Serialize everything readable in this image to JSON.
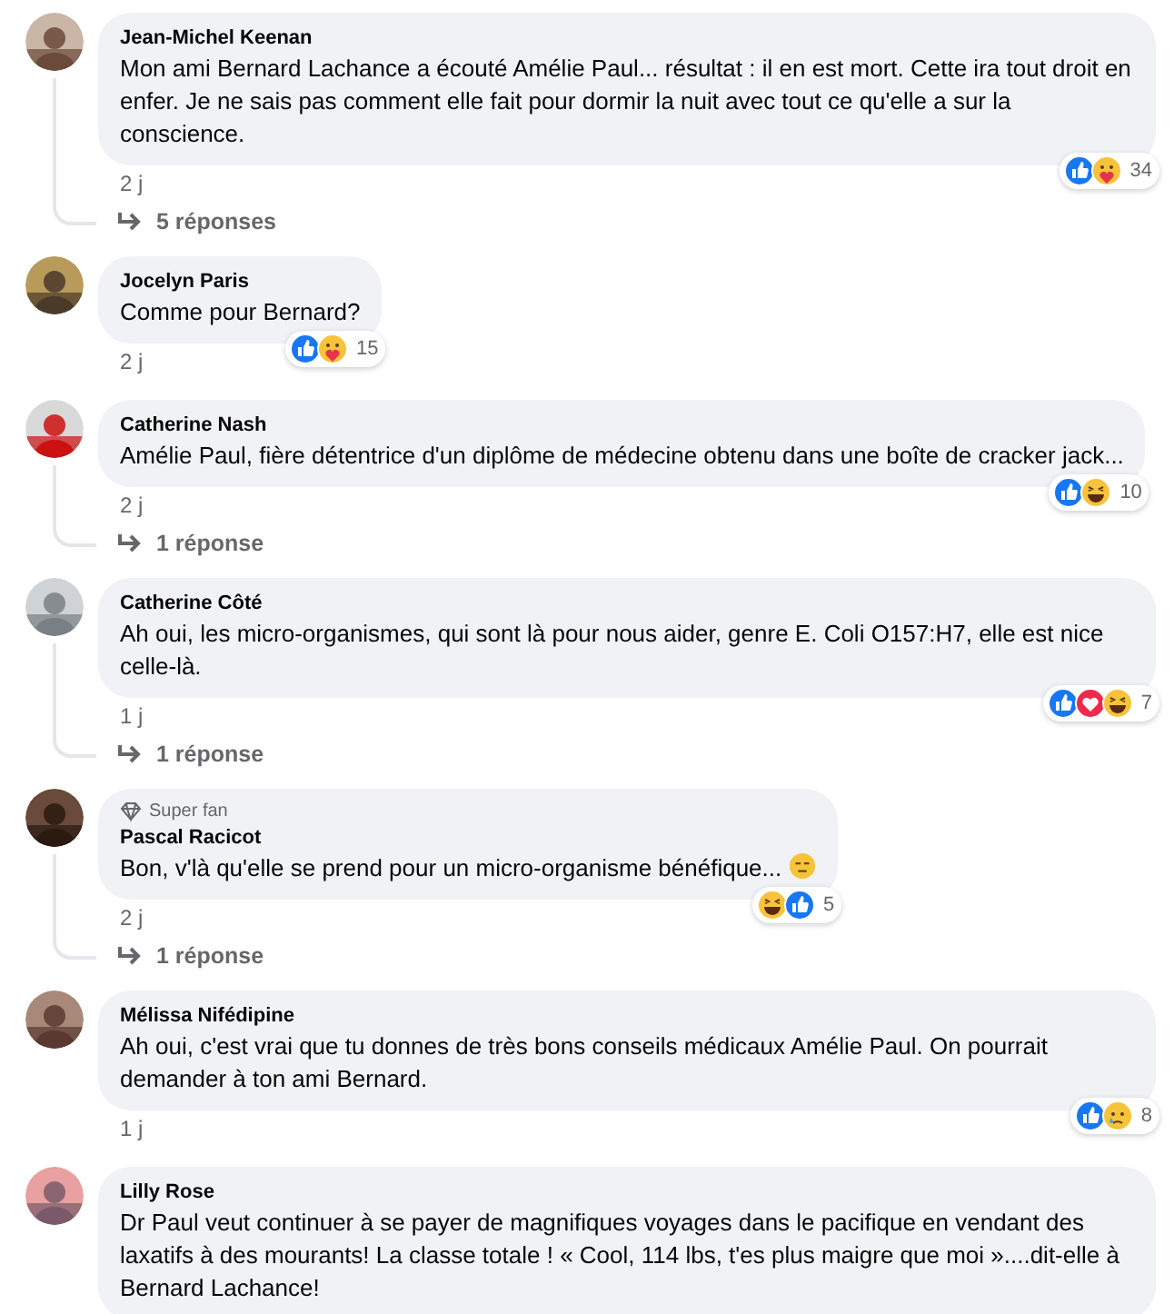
{
  "comments": [
    {
      "author": "Jean-Michel Keenan",
      "text": "Mon ami Bernard Lachance a écouté Amélie Paul... résultat : il en est mort. Cette ira tout droit en enfer. Je ne sais pas comment elle fait pour dormir la nuit avec tout ce qu'elle a sur la conscience.",
      "reactions": {
        "items": [
          {
            "kind": "like"
          },
          {
            "kind": "care"
          }
        ],
        "count": "34"
      },
      "time": "2 j",
      "replies": "5 réponses"
    },
    {
      "author": "Jocelyn Paris",
      "text": "Comme pour Bernard?",
      "reactions": {
        "items": [
          {
            "kind": "like"
          },
          {
            "kind": "care"
          }
        ],
        "count": "15"
      },
      "time": "2 j"
    },
    {
      "author": "Catherine Nash",
      "text": "Amélie Paul, fière détentrice d'un diplôme de médecine obtenu dans une boîte de cracker jack...",
      "reactions": {
        "items": [
          {
            "kind": "like"
          },
          {
            "kind": "haha"
          }
        ],
        "count": "10"
      },
      "time": "2 j",
      "replies": "1 réponse"
    },
    {
      "author": "Catherine Côté",
      "text": "Ah oui, les micro-organismes, qui sont là pour nous aider, genre E. Coli O157:H7, elle est nice celle-là.",
      "reactions": {
        "items": [
          {
            "kind": "like"
          },
          {
            "kind": "love"
          },
          {
            "kind": "haha"
          }
        ],
        "count": "7"
      },
      "time": "1 j",
      "replies": "1 réponse"
    },
    {
      "author": "Pascal Racicot",
      "badge": "Super fan",
      "text": "Bon, v'là qu'elle se prend pour un micro-organisme bénéfique...",
      "trailing_emoji": {
        "kind": "expressionless"
      },
      "reactions": {
        "items": [
          {
            "kind": "haha"
          },
          {
            "kind": "like"
          }
        ],
        "count": "5"
      },
      "time": "2 j",
      "replies": "1 réponse"
    },
    {
      "author": "Mélissa Nifédipine",
      "text": "Ah oui, c'est vrai que tu donnes de très bons conseils médicaux Amélie Paul. On pourrait demander à ton ami Bernard.",
      "reactions": {
        "items": [
          {
            "kind": "like"
          },
          {
            "kind": "sad"
          }
        ],
        "count": "8"
      },
      "time": "1 j"
    },
    {
      "author": "Lilly Rose",
      "text": "Dr Paul veut continuer à se payer de magnifiques voyages dans le pacifique en vendant des laxatifs à des mourants! La classe totale ! « Cool, 114 lbs, t'es plus maigre que moi »....dit-elle à Bernard Lachance!"
    }
  ]
}
